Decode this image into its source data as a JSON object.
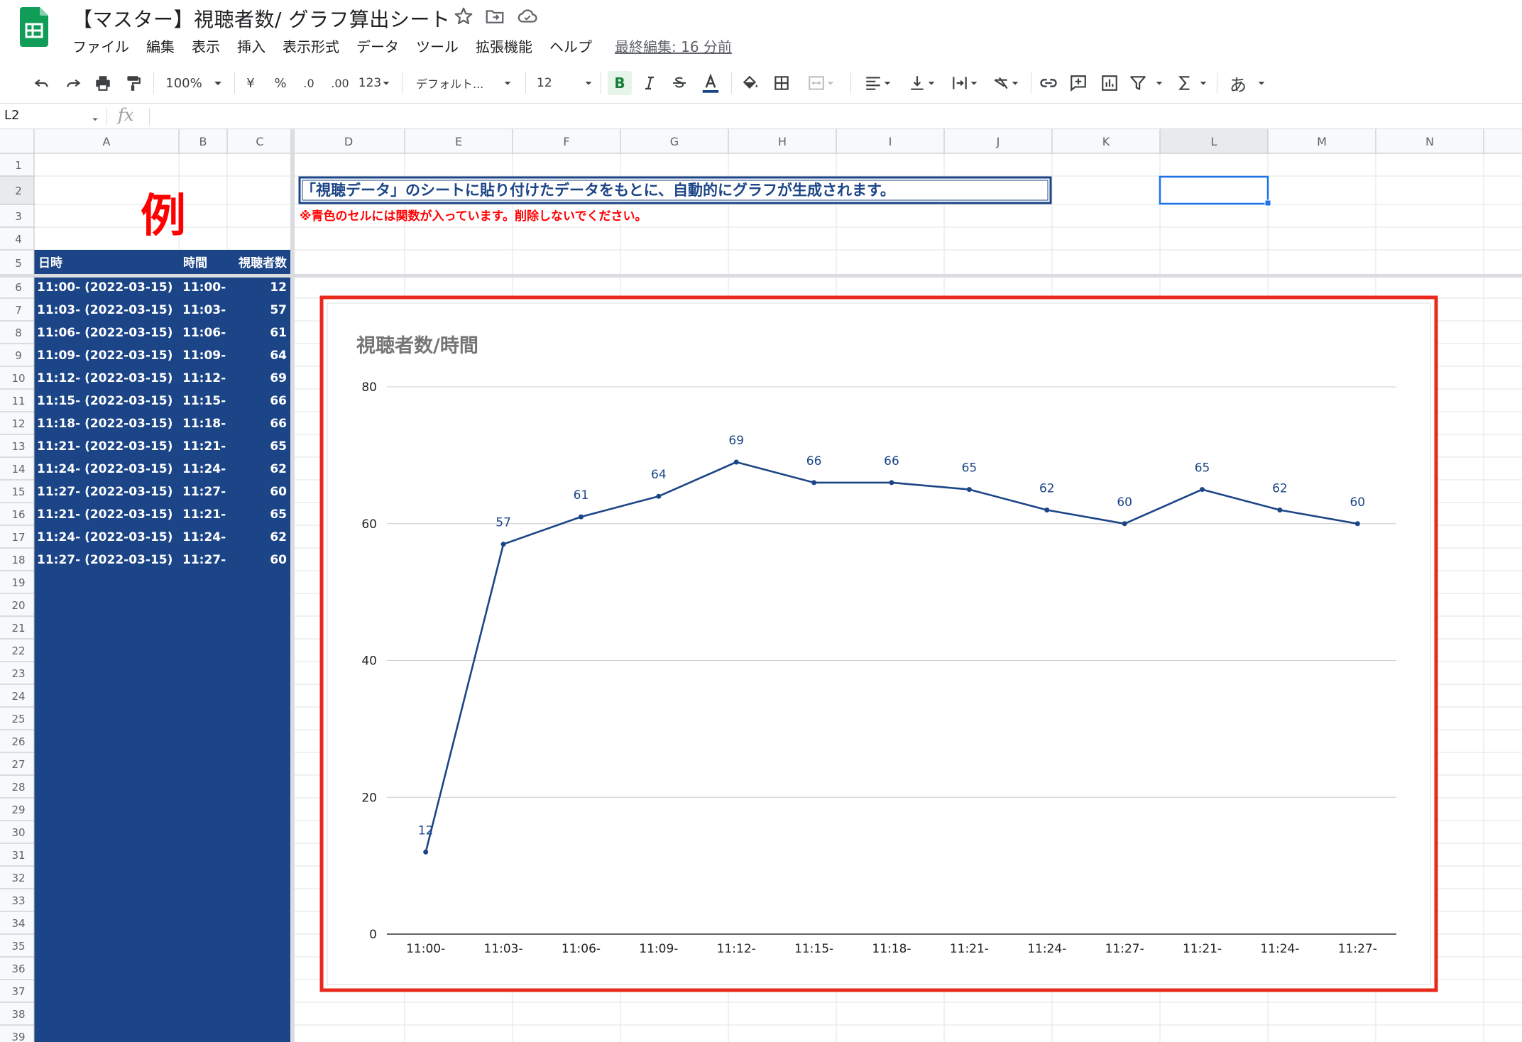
{
  "doc_title": "【マスター】視聴者数/ グラフ算出シート",
  "menu": [
    "ファイル",
    "編集",
    "表示",
    "挿入",
    "表示形式",
    "データ",
    "ツール",
    "拡張機能",
    "ヘルプ"
  ],
  "last_edit": "最終編集: 16 分前",
  "toolbar": {
    "zoom": "100%",
    "currency": "¥",
    "percent": "%",
    "dec_decrease": ".0",
    "dec_increase": ".00",
    "format_more": "123",
    "font": "デフォルト...",
    "font_size": "12",
    "bold": "B",
    "input_tools": "あ"
  },
  "name_box": "L2",
  "fx_label": "fx",
  "columns": [
    "A",
    "B",
    "C",
    "D",
    "E",
    "F",
    "G",
    "H",
    "I",
    "J",
    "K",
    "L",
    "M",
    "N"
  ],
  "rows": [
    "1",
    "2",
    "3",
    "4",
    "5",
    "6",
    "7",
    "8",
    "9",
    "10",
    "11",
    "12",
    "13",
    "14",
    "15",
    "16",
    "17",
    "18",
    "19",
    "20",
    "21",
    "22",
    "23",
    "24",
    "25",
    "26",
    "27",
    "28",
    "29",
    "30",
    "31",
    "32",
    "33",
    "34",
    "35",
    "36",
    "37",
    "38",
    "39"
  ],
  "example_label": "例",
  "instruction": "「視聴データ」のシートに貼り付けたデータをもとに、自動的にグラフが生成されます。",
  "warning": "※青色のセルには関数が入っています。削除しないでください。",
  "table": {
    "headers": [
      "日時",
      "時間",
      "視聴者数"
    ],
    "rows": [
      [
        "11:00- (2022-03-15)",
        "11:00-",
        "12"
      ],
      [
        "11:03- (2022-03-15)",
        "11:03-",
        "57"
      ],
      [
        "11:06- (2022-03-15)",
        "11:06-",
        "61"
      ],
      [
        "11:09- (2022-03-15)",
        "11:09-",
        "64"
      ],
      [
        "11:12- (2022-03-15)",
        "11:12-",
        "69"
      ],
      [
        "11:15- (2022-03-15)",
        "11:15-",
        "66"
      ],
      [
        "11:18- (2022-03-15)",
        "11:18-",
        "66"
      ],
      [
        "11:21- (2022-03-15)",
        "11:21-",
        "65"
      ],
      [
        "11:24- (2022-03-15)",
        "11:24-",
        "62"
      ],
      [
        "11:27- (2022-03-15)",
        "11:27-",
        "60"
      ],
      [
        "11:21- (2022-03-15)",
        "11:21-",
        "65"
      ],
      [
        "11:24- (2022-03-15)",
        "11:24-",
        "62"
      ],
      [
        "11:27- (2022-03-15)",
        "11:27-",
        "60"
      ]
    ]
  },
  "colors": {
    "table_bg": "#1c4587",
    "line": "#1c4587",
    "highlight_border": "#e8291c",
    "red_text": "#ff0000",
    "selection": "#1a73e8",
    "sheets_green": "#0f9d58"
  },
  "chart_data": {
    "type": "line",
    "title": "視聴者数/時間",
    "categories": [
      "11:00-",
      "11:03-",
      "11:06-",
      "11:09-",
      "11:12-",
      "11:15-",
      "11:18-",
      "11:21-",
      "11:24-",
      "11:27-",
      "11:21-",
      "11:24-",
      "11:27-"
    ],
    "series": [
      {
        "values": [
          12,
          57,
          61,
          64,
          69,
          66,
          66,
          65,
          62,
          60,
          65,
          62,
          60
        ]
      }
    ],
    "yticks": [
      0,
      20,
      40,
      60,
      80
    ],
    "ylim": [
      0,
      80
    ],
    "grid": true,
    "data_labels": true
  }
}
